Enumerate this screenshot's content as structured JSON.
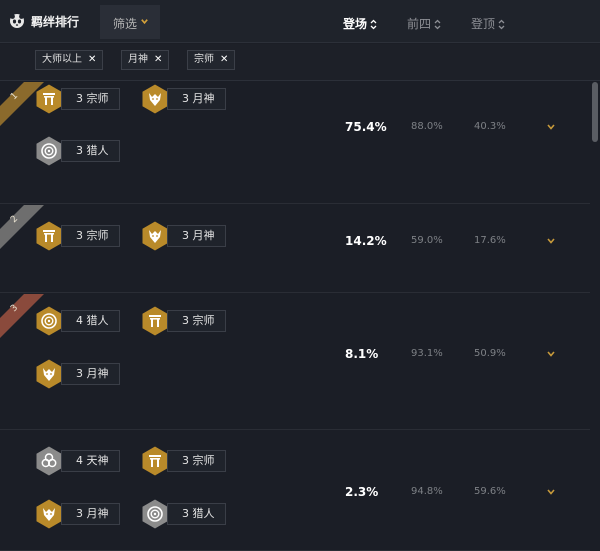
{
  "header": {
    "title": "羁绊排行",
    "filter_label": "筛选",
    "columns": [
      {
        "label": "登场",
        "active": true
      },
      {
        "label": "前四",
        "active": false
      },
      {
        "label": "登顶",
        "active": false
      }
    ]
  },
  "filters": [
    "大师以上",
    "月神",
    "宗师"
  ],
  "rows": [
    {
      "rank": "1",
      "traits": [
        {
          "count": "3",
          "name": "宗师",
          "icon": "gate-icon",
          "tier": "gold"
        },
        {
          "count": "3",
          "name": "月神",
          "icon": "moon-wolf-icon",
          "tier": "gold"
        },
        {
          "count": "3",
          "name": "猎人",
          "icon": "target-icon",
          "tier": "silver"
        }
      ],
      "play_rate": "75.4%",
      "top4": "88.0%",
      "win": "40.3%"
    },
    {
      "rank": "2",
      "traits": [
        {
          "count": "3",
          "name": "宗师",
          "icon": "gate-icon",
          "tier": "gold"
        },
        {
          "count": "3",
          "name": "月神",
          "icon": "moon-wolf-icon",
          "tier": "gold"
        }
      ],
      "play_rate": "14.2%",
      "top4": "59.0%",
      "win": "17.6%"
    },
    {
      "rank": "3",
      "traits": [
        {
          "count": "4",
          "name": "猎人",
          "icon": "target-icon",
          "tier": "gold"
        },
        {
          "count": "3",
          "name": "宗师",
          "icon": "gate-icon",
          "tier": "gold"
        },
        {
          "count": "3",
          "name": "月神",
          "icon": "moon-wolf-icon",
          "tier": "gold"
        }
      ],
      "play_rate": "8.1%",
      "top4": "93.1%",
      "win": "50.9%"
    },
    {
      "rank": "",
      "traits": [
        {
          "count": "4",
          "name": "天神",
          "icon": "celestial-knot-icon",
          "tier": "silver"
        },
        {
          "count": "3",
          "name": "宗师",
          "icon": "gate-icon",
          "tier": "gold"
        },
        {
          "count": "3",
          "name": "月神",
          "icon": "moon-wolf-icon",
          "tier": "gold"
        },
        {
          "count": "3",
          "name": "猎人",
          "icon": "target-icon",
          "tier": "silver"
        }
      ],
      "play_rate": "2.3%",
      "top4": "94.8%",
      "win": "59.6%"
    }
  ],
  "colors": {
    "gold": "#b98a2a",
    "silver": "#8b8b8b",
    "rank1": "#8b6a2c",
    "rank2": "#6e6e6e",
    "rank3": "#8a4a3c"
  }
}
